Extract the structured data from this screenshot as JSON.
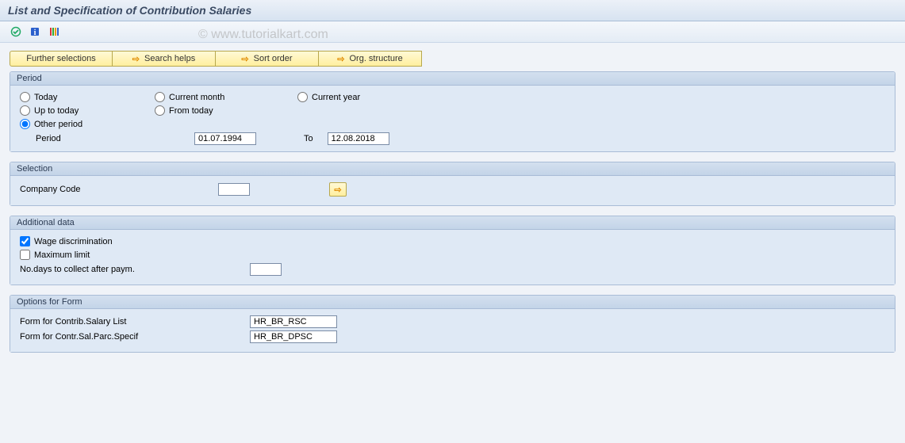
{
  "title": "List and Specification of Contribution Salaries",
  "watermark": "© www.tutorialkart.com",
  "toolbar_buttons": {
    "further_selections": "Further selections",
    "search_helps": "Search helps",
    "sort_order": "Sort order",
    "org_structure": "Org. structure"
  },
  "period": {
    "group_title": "Period",
    "today": "Today",
    "current_month": "Current month",
    "current_year": "Current year",
    "up_to_today": "Up to today",
    "from_today": "From today",
    "other_period": "Other period",
    "period_label": "Period",
    "from_value": "01.07.1994",
    "to_label": "To",
    "to_value": "12.08.2018"
  },
  "selection": {
    "group_title": "Selection",
    "company_code": "Company Code",
    "company_code_value": ""
  },
  "additional": {
    "group_title": "Additional data",
    "wage_disc": "Wage discrimination",
    "max_limit": "Maximum limit",
    "no_days": "No.days to collect after paym.",
    "no_days_value": ""
  },
  "form_opts": {
    "group_title": "Options for Form",
    "contrib_list_label": "Form for Contrib.Salary List",
    "contrib_list_value": "HR_BR_RSC",
    "parc_spec_label": "Form for Contr.Sal.Parc.Specif",
    "parc_spec_value": "HR_BR_DPSC"
  }
}
